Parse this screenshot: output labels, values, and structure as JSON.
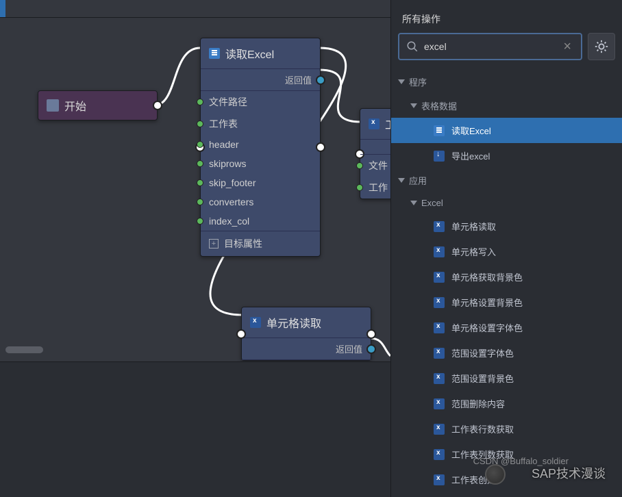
{
  "panel": {
    "title": "所有操作",
    "search_value": "excel"
  },
  "tree": {
    "group1": "程序",
    "group1_sub": "表格数据",
    "item_read_excel": "读取Excel",
    "item_export_excel": "导出excel",
    "group2": "应用",
    "group2_sub": "Excel",
    "items": [
      "单元格读取",
      "单元格写入",
      "单元格获取背景色",
      "单元格设置背景色",
      "单元格设置字体色",
      "范围设置字体色",
      "范围设置背景色",
      "范围删除内容",
      "工作表行数获取",
      "工作表列数获取",
      "工作表创建"
    ]
  },
  "nodes": {
    "start": "开始",
    "read_excel": {
      "title": "读取Excel",
      "ret": "返回值",
      "rows": [
        "文件路径",
        "工作表",
        "header",
        "skiprows",
        "skip_footer",
        "converters",
        "index_col"
      ],
      "attr": "目标属性"
    },
    "partial": {
      "title": "工...",
      "row1": "文件",
      "row2": "工作"
    },
    "cell_read": {
      "title": "单元格读取",
      "ret": "返回值"
    }
  },
  "watermark": {
    "main": "SAP技术漫谈",
    "sub": "CSDN @Buffalo_soldier"
  }
}
